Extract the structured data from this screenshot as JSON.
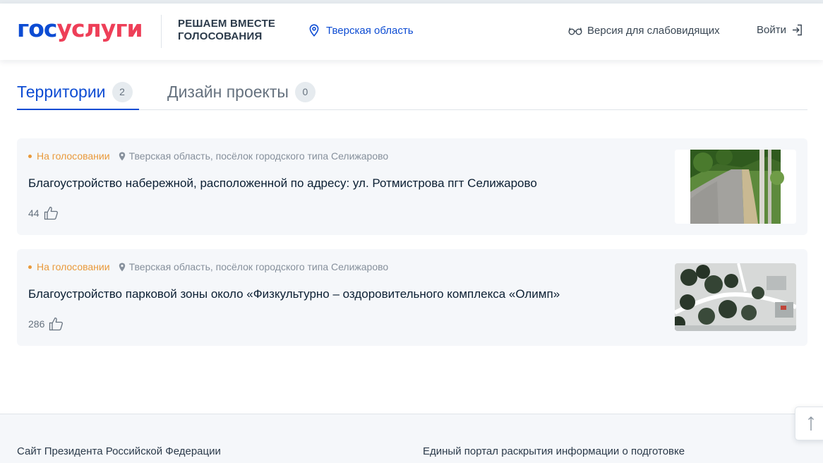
{
  "header": {
    "logo_part1": "гос",
    "logo_part2": "услуги",
    "project_title_line1": "РЕШАЕМ ВМЕСТЕ",
    "project_title_line2": "ГОЛОСОВАНИЯ",
    "region": "Тверская область",
    "accessibility_label": "Версия для слабовидящих",
    "login_label": "Войти"
  },
  "tabs": [
    {
      "label": "Территории",
      "count": "2",
      "active": true
    },
    {
      "label": "Дизайн проекты",
      "count": "0",
      "active": false
    }
  ],
  "cards": [
    {
      "status": "На голосовании",
      "location": "Тверская область, посёлок городского типа Селижарово",
      "title": "Благоустройство набережной, расположенной по адресу: ул. Ротмистрова пгт Селижарово",
      "likes": "44",
      "image_icon": "embankment-photo"
    },
    {
      "status": "На голосовании",
      "location": "Тверская область, посёлок городского типа Селижарово",
      "title": "Благоустройство парковой зоны около «Физкультурно – оздоровительного комплекса «Олимп»",
      "likes": "286",
      "image_icon": "park-aerial-photo"
    }
  ],
  "footer": {
    "link1": "Сайт Президента Российской Федерации",
    "link2": "Единый портал раскрытия информации о подготовке"
  },
  "colors": {
    "brand_blue": "#0d4cd3",
    "brand_red": "#ee3f58",
    "status_orange": "#e9993a",
    "card_bg": "#f5f7fa"
  },
  "icons": {
    "region": "map-pin-icon",
    "accessibility": "glasses-icon",
    "login": "login-arrow-icon",
    "location": "location-pin-icon",
    "like": "thumbs-up-icon",
    "scroll_top": "arrow-up-icon"
  }
}
